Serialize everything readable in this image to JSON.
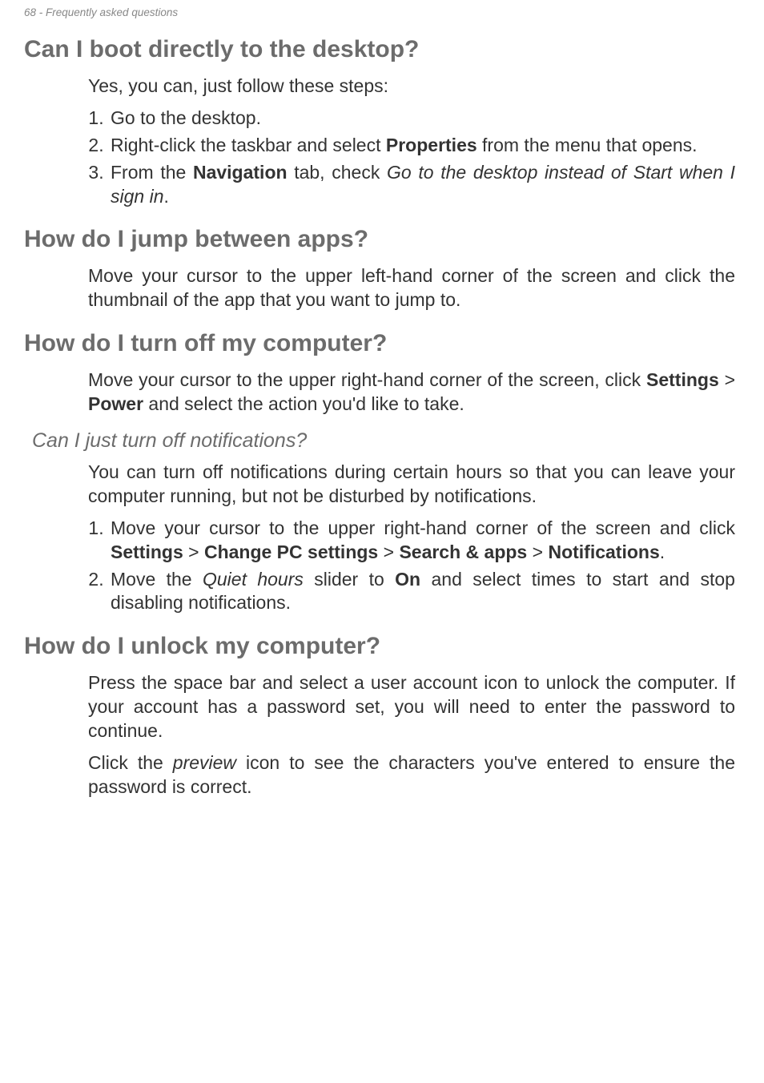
{
  "header": "68 - Frequently asked questions",
  "sections": {
    "s1": {
      "title": "Can I boot directly to the desktop?",
      "intro": "Yes, you can, just follow these steps:",
      "steps": {
        "a": "Go to the desktop.",
        "b_pre": "Right-click the taskbar and select ",
        "b_bold": "Properties",
        "b_post": " from the menu that opens.",
        "c_pre": "From the ",
        "c_bold": "Navigation",
        "c_mid": " tab, check ",
        "c_ital": "Go to the desktop instead of Start when I sign in",
        "c_post": "."
      }
    },
    "s2": {
      "title": "How do I jump between apps?",
      "body": "Move your cursor to the upper left-hand corner of the screen and click the thumbnail of the app that you want to jump to."
    },
    "s3": {
      "title": "How do I turn off my computer?",
      "body_pre": "Move your cursor to the upper right-hand corner of the screen, click ",
      "body_b1": "Settings",
      "body_mid": " > ",
      "body_b2": "Power",
      "body_post": " and select the action you'd like to take.",
      "sub_title": "Can I just turn off notifications?",
      "sub_body": "You can turn off notifications during certain hours so that you can leave your computer running, but not be disturbed by notifications.",
      "sub_steps": {
        "a_pre": "Move your cursor to the upper right-hand corner of the screen and click ",
        "a_b1": "Settings",
        "a_g1": " > ",
        "a_b2": "Change PC settings",
        "a_g2": " > ",
        "a_b3": "Search & apps",
        "a_g3": " > ",
        "a_b4": "Notifications",
        "a_post": ".",
        "b_pre": "Move the ",
        "b_ital": "Quiet hours",
        "b_mid": " slider to ",
        "b_bold": "On",
        "b_post": " and select times to start and stop disabling notifications."
      }
    },
    "s4": {
      "title": "How do I unlock my computer?",
      "body1": "Press the space bar and select a user account icon to unlock the computer. If your account has a password set, you will need to enter the password to continue.",
      "body2_pre": "Click the ",
      "body2_ital": "preview",
      "body2_post": " icon to see the characters you've entered to ensure the password is correct."
    }
  }
}
